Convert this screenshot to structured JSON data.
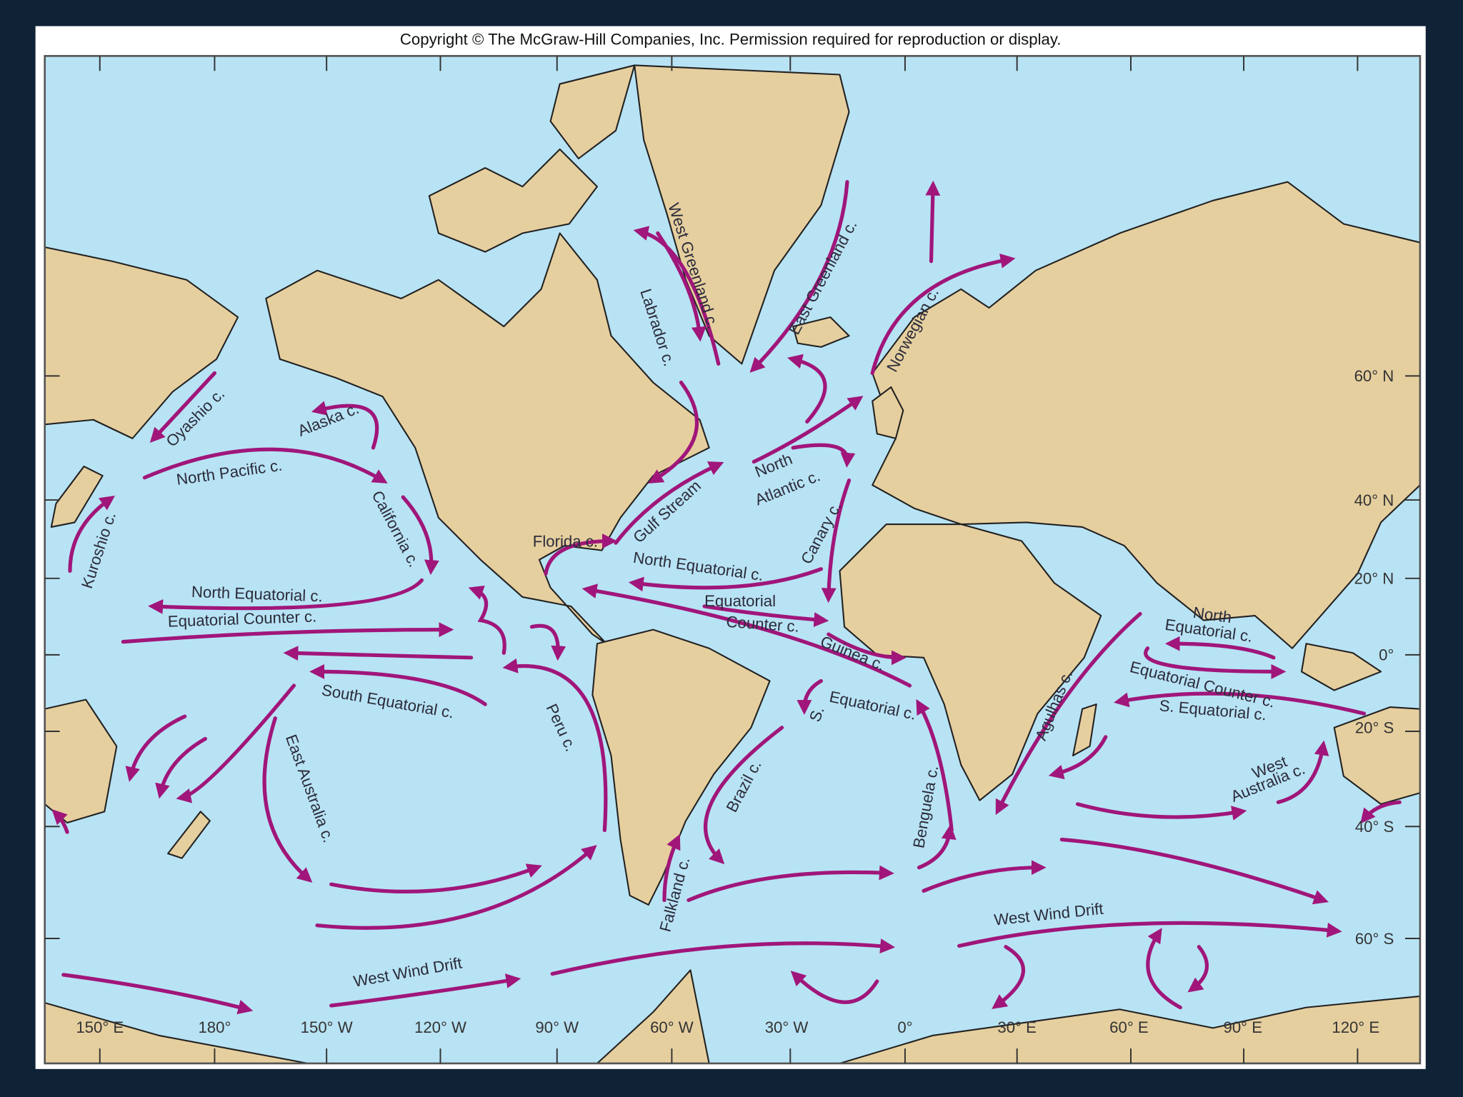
{
  "copyright": "Copyright © The McGraw-Hill Companies, Inc. Permission required for reproduction or display.",
  "colors": {
    "ocean": "#b8e3f4",
    "land": "#e6cf9f",
    "current_arrows": "#a0167a",
    "background": "#0f2236"
  },
  "longitude_labels": [
    "150° E",
    "180°",
    "150° W",
    "120° W",
    "90° W",
    "60° W",
    "30° W",
    "0°",
    "30° E",
    "60° E",
    "90° E",
    "120° E"
  ],
  "latitude_labels": [
    "60° N",
    "40° N",
    "20° N",
    "0°",
    "20° S",
    "40° S",
    "60° S"
  ],
  "currents": {
    "oyashio": "Oyashio c.",
    "alaska": "Alaska c.",
    "north_pacific": "North Pacific c.",
    "kuroshio": "Kuroshio c.",
    "california": "California c.",
    "pacific_north_equatorial": "North Equatorial c.",
    "pacific_equatorial_counter": "Equatorial Counter c.",
    "pacific_south_equatorial": "South Equatorial c.",
    "east_australia": "East Australia c.",
    "peru": "Peru c.",
    "west_wind_drift_1": "West Wind Drift",
    "west_wind_drift_2": "West Wind Drift",
    "florida": "Florida c.",
    "gulf_stream": "Gulf Stream",
    "west_greenland": "West Greenland c.",
    "labrador": "Labrador c.",
    "east_greenland": "East Greenland c.",
    "norwegian": "Norwegian c.",
    "north_atlantic": [
      "North",
      "Atlantic c."
    ],
    "canary": "Canary c.",
    "atlantic_north_equatorial": "North Equatorial c.",
    "atlantic_equatorial_counter": [
      "Equatorial",
      "Counter c."
    ],
    "guinea": "Guinea c.",
    "atlantic_s_equatorial": [
      "S.",
      "Equatorial c."
    ],
    "brazil": "Brazil c.",
    "benguela": "Benguela c.",
    "falkland": "Falkland c.",
    "agulhas": "Agulhas c.",
    "indian_north_equatorial": [
      "North",
      "Equatorial c."
    ],
    "indian_equatorial_counter": "Equatorial Counter c.",
    "indian_s_equatorial": "S. Equatorial c.",
    "west_australia": [
      "West",
      "Australia c."
    ]
  }
}
